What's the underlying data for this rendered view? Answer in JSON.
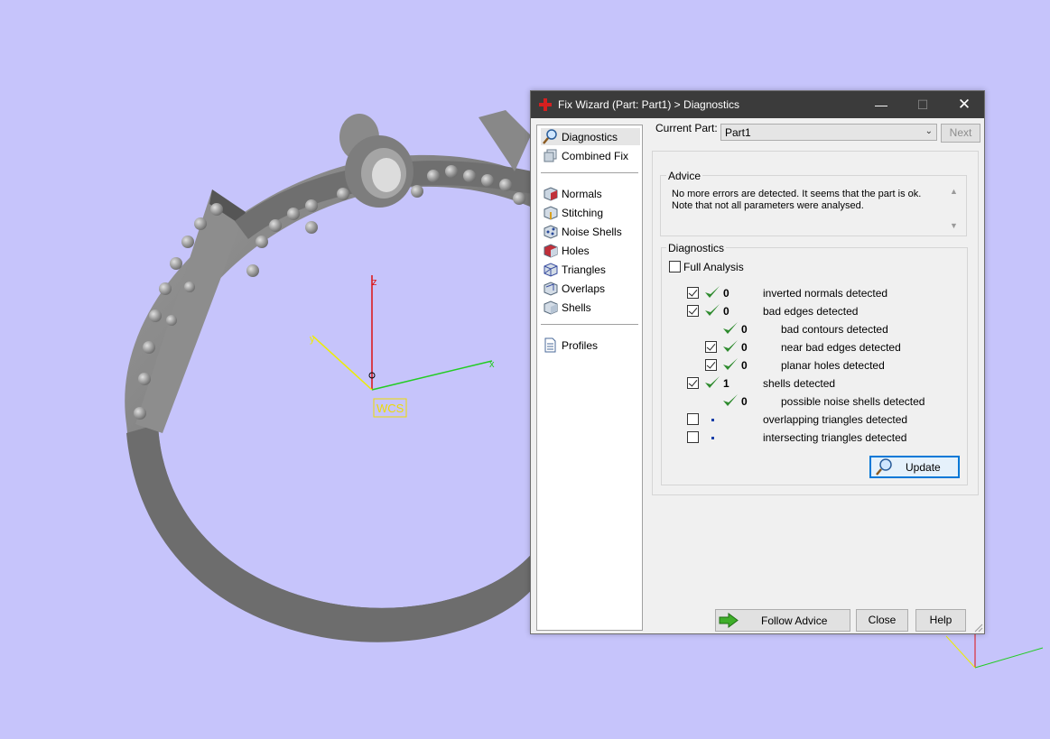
{
  "window": {
    "title": "Fix Wizard (Part: Part1) > Diagnostics",
    "controls": {
      "minimize": "—",
      "maximize": "☐",
      "close": "✕"
    }
  },
  "viewport": {
    "wcs_label": "WCS",
    "axis_x": "x",
    "axis_y": "y",
    "axis_z": "z"
  },
  "nav": {
    "items": [
      {
        "label": "Diagnostics",
        "icon": "magnifier-icon",
        "selected": true
      },
      {
        "label": "Combined Fix",
        "icon": "combined-fix-icon"
      },
      {
        "label": "Normals",
        "icon": "normals-cube-icon"
      },
      {
        "label": "Stitching",
        "icon": "stitching-cube-icon"
      },
      {
        "label": "Noise Shells",
        "icon": "noise-shells-cube-icon"
      },
      {
        "label": "Holes",
        "icon": "holes-cube-icon"
      },
      {
        "label": "Triangles",
        "icon": "triangles-cube-icon"
      },
      {
        "label": "Overlaps",
        "icon": "overlaps-cube-icon"
      },
      {
        "label": "Shells",
        "icon": "shells-cube-icon"
      },
      {
        "label": "Profiles",
        "icon": "profiles-document-icon"
      }
    ]
  },
  "current_part": {
    "label": "Current Part:",
    "value": "Part1",
    "next_label": "Next"
  },
  "advice": {
    "title": "Advice",
    "text": "No more errors are detected. It seems that the part is ok.\nNote that not all parameters were analysed."
  },
  "diagnostics": {
    "title": "Diagnostics",
    "full_analysis_label": "Full Analysis",
    "full_analysis_checked": false,
    "rows": [
      {
        "checked": true,
        "status": "ok",
        "count": "0",
        "label": "inverted normals detected"
      },
      {
        "checked": true,
        "status": "ok",
        "count": "0",
        "label": "bad edges detected"
      },
      {
        "status": "ok",
        "count": "0",
        "label": "bad contours detected"
      },
      {
        "checked": true,
        "status": "ok",
        "count": "0",
        "label": "near bad edges detected"
      },
      {
        "checked": true,
        "status": "ok",
        "count": "0",
        "label": "planar holes detected"
      },
      {
        "checked": true,
        "status": "ok",
        "count": "1",
        "label": "shells detected"
      },
      {
        "status": "ok",
        "count": "0",
        "label": "possible noise shells detected"
      },
      {
        "checked": false,
        "status": "pending",
        "label": "overlapping triangles detected"
      },
      {
        "checked": false,
        "status": "pending",
        "label": "intersecting triangles detected"
      }
    ],
    "update_label": "Update"
  },
  "footer": {
    "follow_advice": "Follow Advice",
    "close": "Close",
    "help": "Help"
  },
  "colors": {
    "background": "#c6c4fb",
    "titlebar": "#3b3b3b",
    "check_green": "#2e8b2e",
    "accent_blue": "#0078d7"
  }
}
